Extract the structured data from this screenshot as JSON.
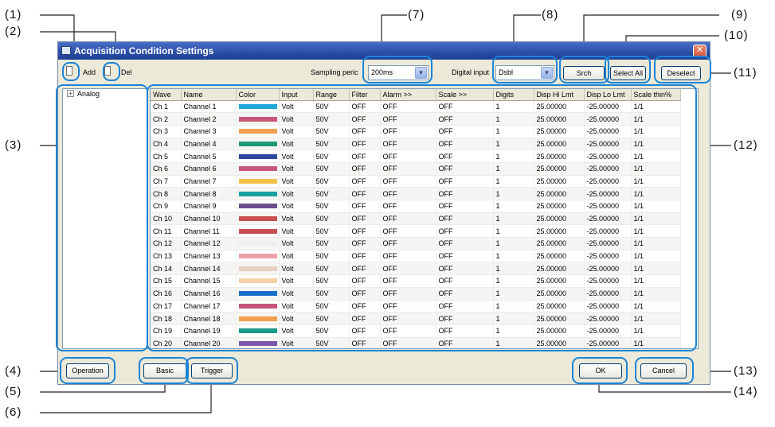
{
  "window": {
    "title": "Acquisition Condition Settings",
    "close_glyph": "✕"
  },
  "toolbar": {
    "add_label": "Add",
    "del_label": "Del",
    "sampling_label": "Sampling peric",
    "sampling_value": "200ms",
    "digital_label": "Digital input",
    "digital_value": "Dsbl",
    "search_label": "Srch",
    "select_all_label": "Select All",
    "deselect_label": "Deselect"
  },
  "tree": {
    "expander": "+",
    "root_label": "Analog"
  },
  "table": {
    "columns": [
      "Wave",
      "Name",
      "Color",
      "Input",
      "Range",
      "Filter",
      "Alarm  >>",
      "Scale  >>",
      "Digits",
      "Disp Hi Lmt",
      "Disp Lo Lmt",
      "Scale thin%"
    ],
    "rows": [
      {
        "wave": "Ch 1",
        "name": "Channel 1",
        "color": "#1ea8d8",
        "input": "Volt",
        "range": "50V",
        "filter": "OFF",
        "alarm": "OFF",
        "scale": "OFF",
        "digits": "1",
        "hi": "25.00000",
        "lo": "-25.00000",
        "thin": "1/1"
      },
      {
        "wave": "Ch 2",
        "name": "Channel 2",
        "color": "#c8577a",
        "input": "Volt",
        "range": "50V",
        "filter": "OFF",
        "alarm": "OFF",
        "scale": "OFF",
        "digits": "1",
        "hi": "25.00000",
        "lo": "-25.00000",
        "thin": "1/1"
      },
      {
        "wave": "Ch 3",
        "name": "Channel 3",
        "color": "#f0a050",
        "input": "Volt",
        "range": "50V",
        "filter": "OFF",
        "alarm": "OFF",
        "scale": "OFF",
        "digits": "1",
        "hi": "25.00000",
        "lo": "-25.00000",
        "thin": "1/1"
      },
      {
        "wave": "Ch 4",
        "name": "Channel 4",
        "color": "#1f9a78",
        "input": "Volt",
        "range": "50V",
        "filter": "OFF",
        "alarm": "OFF",
        "scale": "OFF",
        "digits": "1",
        "hi": "25.00000",
        "lo": "-25.00000",
        "thin": "1/1"
      },
      {
        "wave": "Ch 5",
        "name": "Channel 5",
        "color": "#2b4a9c",
        "input": "Volt",
        "range": "50V",
        "filter": "OFF",
        "alarm": "OFF",
        "scale": "OFF",
        "digits": "1",
        "hi": "25.00000",
        "lo": "-25.00000",
        "thin": "1/1"
      },
      {
        "wave": "Ch 6",
        "name": "Channel 6",
        "color": "#c8577a",
        "input": "Volt",
        "range": "50V",
        "filter": "OFF",
        "alarm": "OFF",
        "scale": "OFF",
        "digits": "1",
        "hi": "25.00000",
        "lo": "-25.00000",
        "thin": "1/1"
      },
      {
        "wave": "Ch 7",
        "name": "Channel 7",
        "color": "#f5c048",
        "input": "Volt",
        "range": "50V",
        "filter": "OFF",
        "alarm": "OFF",
        "scale": "OFF",
        "digits": "1",
        "hi": "25.00000",
        "lo": "-25.00000",
        "thin": "1/1"
      },
      {
        "wave": "Ch 8",
        "name": "Channel 8",
        "color": "#1aa0a0",
        "input": "Volt",
        "range": "50V",
        "filter": "OFF",
        "alarm": "OFF",
        "scale": "OFF",
        "digits": "1",
        "hi": "25.00000",
        "lo": "-25.00000",
        "thin": "1/1"
      },
      {
        "wave": "Ch 9",
        "name": "Channel 9",
        "color": "#6a4e8c",
        "input": "Volt",
        "range": "50V",
        "filter": "OFF",
        "alarm": "OFF",
        "scale": "OFF",
        "digits": "1",
        "hi": "25.00000",
        "lo": "-25.00000",
        "thin": "1/1"
      },
      {
        "wave": "Ch 10",
        "name": "Channel 10",
        "color": "#c85050",
        "input": "Volt",
        "range": "50V",
        "filter": "OFF",
        "alarm": "OFF",
        "scale": "OFF",
        "digits": "1",
        "hi": "25.00000",
        "lo": "-25.00000",
        "thin": "1/1"
      },
      {
        "wave": "Ch 11",
        "name": "Channel 11",
        "color": "#c85050",
        "input": "Volt",
        "range": "50V",
        "filter": "OFF",
        "alarm": "OFF",
        "scale": "OFF",
        "digits": "1",
        "hi": "25.00000",
        "lo": "-25.00000",
        "thin": "1/1"
      },
      {
        "wave": "Ch 12",
        "name": "Channel 12",
        "color": "#eeeef0",
        "input": "Volt",
        "range": "50V",
        "filter": "OFF",
        "alarm": "OFF",
        "scale": "OFF",
        "digits": "1",
        "hi": "25.00000",
        "lo": "-25.00000",
        "thin": "1/1"
      },
      {
        "wave": "Ch 13",
        "name": "Channel 13",
        "color": "#f0a0a8",
        "input": "Volt",
        "range": "50V",
        "filter": "OFF",
        "alarm": "OFF",
        "scale": "OFF",
        "digits": "1",
        "hi": "25.00000",
        "lo": "-25.00000",
        "thin": "1/1"
      },
      {
        "wave": "Ch 14",
        "name": "Channel 14",
        "color": "#e8d0c4",
        "input": "Volt",
        "range": "50V",
        "filter": "OFF",
        "alarm": "OFF",
        "scale": "OFF",
        "digits": "1",
        "hi": "25.00000",
        "lo": "-25.00000",
        "thin": "1/1"
      },
      {
        "wave": "Ch 15",
        "name": "Channel 15",
        "color": "#f8d0a8",
        "input": "Volt",
        "range": "50V",
        "filter": "OFF",
        "alarm": "OFF",
        "scale": "OFF",
        "digits": "1",
        "hi": "25.00000",
        "lo": "-25.00000",
        "thin": "1/1"
      },
      {
        "wave": "Ch 16",
        "name": "Channel 16",
        "color": "#1a70c8",
        "input": "Volt",
        "range": "50V",
        "filter": "OFF",
        "alarm": "OFF",
        "scale": "OFF",
        "digits": "1",
        "hi": "25.00000",
        "lo": "-25.00000",
        "thin": "1/1"
      },
      {
        "wave": "Ch 17",
        "name": "Channel 17",
        "color": "#c8577a",
        "input": "Volt",
        "range": "50V",
        "filter": "OFF",
        "alarm": "OFF",
        "scale": "OFF",
        "digits": "1",
        "hi": "25.00000",
        "lo": "-25.00000",
        "thin": "1/1"
      },
      {
        "wave": "Ch 18",
        "name": "Channel 18",
        "color": "#f0a050",
        "input": "Volt",
        "range": "50V",
        "filter": "OFF",
        "alarm": "OFF",
        "scale": "OFF",
        "digits": "1",
        "hi": "25.00000",
        "lo": "-25.00000",
        "thin": "1/1"
      },
      {
        "wave": "Ch 19",
        "name": "Channel 19",
        "color": "#1a9a88",
        "input": "Volt",
        "range": "50V",
        "filter": "OFF",
        "alarm": "OFF",
        "scale": "OFF",
        "digits": "1",
        "hi": "25.00000",
        "lo": "-25.00000",
        "thin": "1/1"
      },
      {
        "wave": "Ch 20",
        "name": "Channel 20",
        "color": "#7a5aa8",
        "input": "Volt",
        "range": "50V",
        "filter": "OFF",
        "alarm": "OFF",
        "scale": "OFF",
        "digits": "1",
        "hi": "25.00000",
        "lo": "-25.00000",
        "thin": "1/1"
      }
    ]
  },
  "bottom": {
    "operation_label": "Operation",
    "basic_label": "Basic",
    "trigger_label": "Trigger",
    "ok_label": "OK",
    "cancel_label": "Cancel"
  },
  "callouts": [
    "(1)",
    "(2)",
    "(3)",
    "(4)",
    "(5)",
    "(6)",
    "(7)",
    "(8)",
    "(9)",
    "(10)",
    "(11)",
    "(12)",
    "(13)",
    "(14)"
  ],
  "colors": {
    "callout_ring": "#1a84d8",
    "title_bar": "#2a4ea4",
    "dialog_bg": "#ece9d8"
  }
}
